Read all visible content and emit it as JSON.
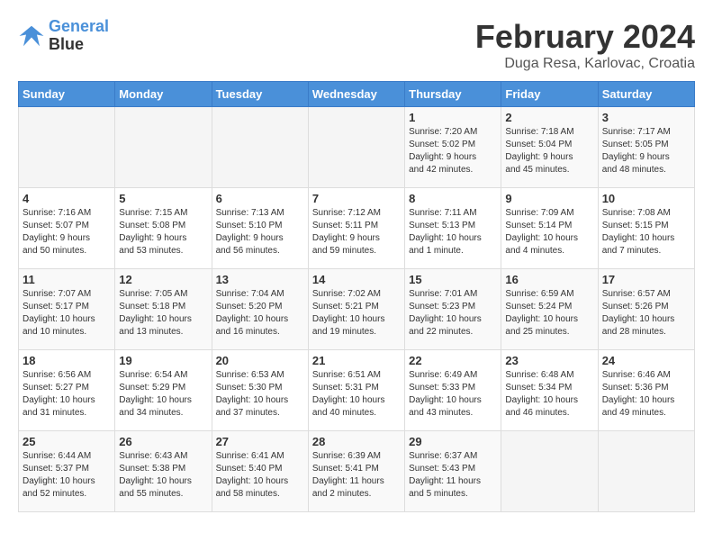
{
  "header": {
    "logo_line1": "General",
    "logo_line2": "Blue",
    "month_title": "February 2024",
    "location": "Duga Resa, Karlovac, Croatia"
  },
  "days_of_week": [
    "Sunday",
    "Monday",
    "Tuesday",
    "Wednesday",
    "Thursday",
    "Friday",
    "Saturday"
  ],
  "weeks": [
    [
      {
        "day": "",
        "info": ""
      },
      {
        "day": "",
        "info": ""
      },
      {
        "day": "",
        "info": ""
      },
      {
        "day": "",
        "info": ""
      },
      {
        "day": "1",
        "info": "Sunrise: 7:20 AM\nSunset: 5:02 PM\nDaylight: 9 hours\nand 42 minutes."
      },
      {
        "day": "2",
        "info": "Sunrise: 7:18 AM\nSunset: 5:04 PM\nDaylight: 9 hours\nand 45 minutes."
      },
      {
        "day": "3",
        "info": "Sunrise: 7:17 AM\nSunset: 5:05 PM\nDaylight: 9 hours\nand 48 minutes."
      }
    ],
    [
      {
        "day": "4",
        "info": "Sunrise: 7:16 AM\nSunset: 5:07 PM\nDaylight: 9 hours\nand 50 minutes."
      },
      {
        "day": "5",
        "info": "Sunrise: 7:15 AM\nSunset: 5:08 PM\nDaylight: 9 hours\nand 53 minutes."
      },
      {
        "day": "6",
        "info": "Sunrise: 7:13 AM\nSunset: 5:10 PM\nDaylight: 9 hours\nand 56 minutes."
      },
      {
        "day": "7",
        "info": "Sunrise: 7:12 AM\nSunset: 5:11 PM\nDaylight: 9 hours\nand 59 minutes."
      },
      {
        "day": "8",
        "info": "Sunrise: 7:11 AM\nSunset: 5:13 PM\nDaylight: 10 hours\nand 1 minute."
      },
      {
        "day": "9",
        "info": "Sunrise: 7:09 AM\nSunset: 5:14 PM\nDaylight: 10 hours\nand 4 minutes."
      },
      {
        "day": "10",
        "info": "Sunrise: 7:08 AM\nSunset: 5:15 PM\nDaylight: 10 hours\nand 7 minutes."
      }
    ],
    [
      {
        "day": "11",
        "info": "Sunrise: 7:07 AM\nSunset: 5:17 PM\nDaylight: 10 hours\nand 10 minutes."
      },
      {
        "day": "12",
        "info": "Sunrise: 7:05 AM\nSunset: 5:18 PM\nDaylight: 10 hours\nand 13 minutes."
      },
      {
        "day": "13",
        "info": "Sunrise: 7:04 AM\nSunset: 5:20 PM\nDaylight: 10 hours\nand 16 minutes."
      },
      {
        "day": "14",
        "info": "Sunrise: 7:02 AM\nSunset: 5:21 PM\nDaylight: 10 hours\nand 19 minutes."
      },
      {
        "day": "15",
        "info": "Sunrise: 7:01 AM\nSunset: 5:23 PM\nDaylight: 10 hours\nand 22 minutes."
      },
      {
        "day": "16",
        "info": "Sunrise: 6:59 AM\nSunset: 5:24 PM\nDaylight: 10 hours\nand 25 minutes."
      },
      {
        "day": "17",
        "info": "Sunrise: 6:57 AM\nSunset: 5:26 PM\nDaylight: 10 hours\nand 28 minutes."
      }
    ],
    [
      {
        "day": "18",
        "info": "Sunrise: 6:56 AM\nSunset: 5:27 PM\nDaylight: 10 hours\nand 31 minutes."
      },
      {
        "day": "19",
        "info": "Sunrise: 6:54 AM\nSunset: 5:29 PM\nDaylight: 10 hours\nand 34 minutes."
      },
      {
        "day": "20",
        "info": "Sunrise: 6:53 AM\nSunset: 5:30 PM\nDaylight: 10 hours\nand 37 minutes."
      },
      {
        "day": "21",
        "info": "Sunrise: 6:51 AM\nSunset: 5:31 PM\nDaylight: 10 hours\nand 40 minutes."
      },
      {
        "day": "22",
        "info": "Sunrise: 6:49 AM\nSunset: 5:33 PM\nDaylight: 10 hours\nand 43 minutes."
      },
      {
        "day": "23",
        "info": "Sunrise: 6:48 AM\nSunset: 5:34 PM\nDaylight: 10 hours\nand 46 minutes."
      },
      {
        "day": "24",
        "info": "Sunrise: 6:46 AM\nSunset: 5:36 PM\nDaylight: 10 hours\nand 49 minutes."
      }
    ],
    [
      {
        "day": "25",
        "info": "Sunrise: 6:44 AM\nSunset: 5:37 PM\nDaylight: 10 hours\nand 52 minutes."
      },
      {
        "day": "26",
        "info": "Sunrise: 6:43 AM\nSunset: 5:38 PM\nDaylight: 10 hours\nand 55 minutes."
      },
      {
        "day": "27",
        "info": "Sunrise: 6:41 AM\nSunset: 5:40 PM\nDaylight: 10 hours\nand 58 minutes."
      },
      {
        "day": "28",
        "info": "Sunrise: 6:39 AM\nSunset: 5:41 PM\nDaylight: 11 hours\nand 2 minutes."
      },
      {
        "day": "29",
        "info": "Sunrise: 6:37 AM\nSunset: 5:43 PM\nDaylight: 11 hours\nand 5 minutes."
      },
      {
        "day": "",
        "info": ""
      },
      {
        "day": "",
        "info": ""
      }
    ]
  ]
}
